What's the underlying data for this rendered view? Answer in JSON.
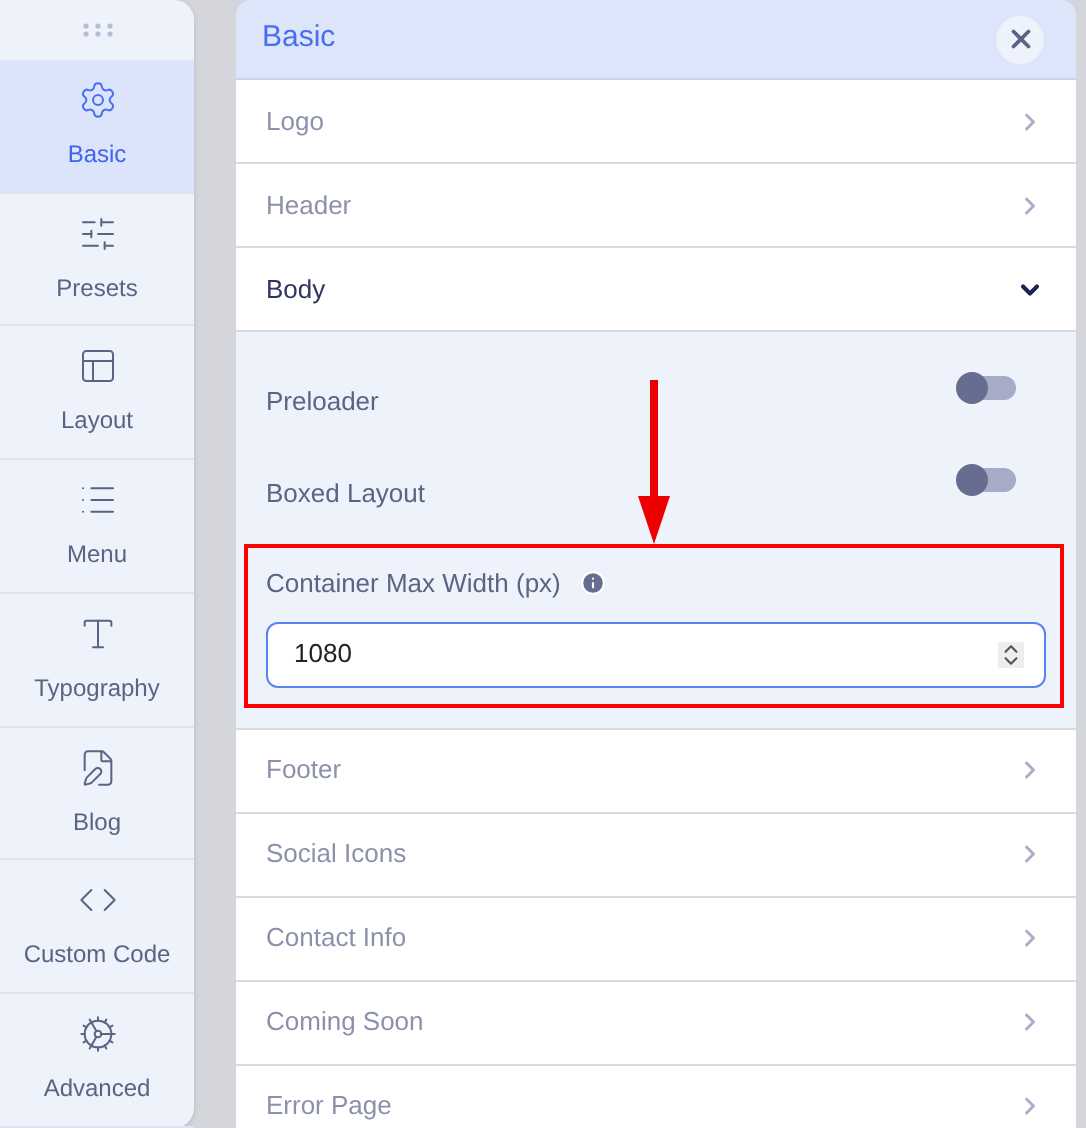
{
  "sidebar": {
    "items": [
      {
        "label": "Basic",
        "selected": true
      },
      {
        "label": "Presets",
        "selected": false
      },
      {
        "label": "Layout",
        "selected": false
      },
      {
        "label": "Menu",
        "selected": false
      },
      {
        "label": "Typography",
        "selected": false
      },
      {
        "label": "Blog",
        "selected": false
      },
      {
        "label": "Custom Code",
        "selected": false
      },
      {
        "label": "Advanced",
        "selected": false
      }
    ]
  },
  "panel": {
    "title": "Basic",
    "sections": [
      {
        "label": "Logo",
        "expanded": false
      },
      {
        "label": "Header",
        "expanded": false
      },
      {
        "label": "Body",
        "expanded": true,
        "fields": [
          {
            "kind": "toggle",
            "label": "Preloader",
            "on": false
          },
          {
            "kind": "toggle",
            "label": "Boxed Layout",
            "on": false
          },
          {
            "kind": "number",
            "label": "Container Max Width (px)",
            "value": "1080",
            "highlighted": true
          }
        ]
      },
      {
        "label": "Footer",
        "expanded": false
      },
      {
        "label": "Social Icons",
        "expanded": false
      },
      {
        "label": "Contact Info",
        "expanded": false
      },
      {
        "label": "Coming Soon",
        "expanded": false
      },
      {
        "label": "Error Page",
        "expanded": false
      }
    ]
  }
}
